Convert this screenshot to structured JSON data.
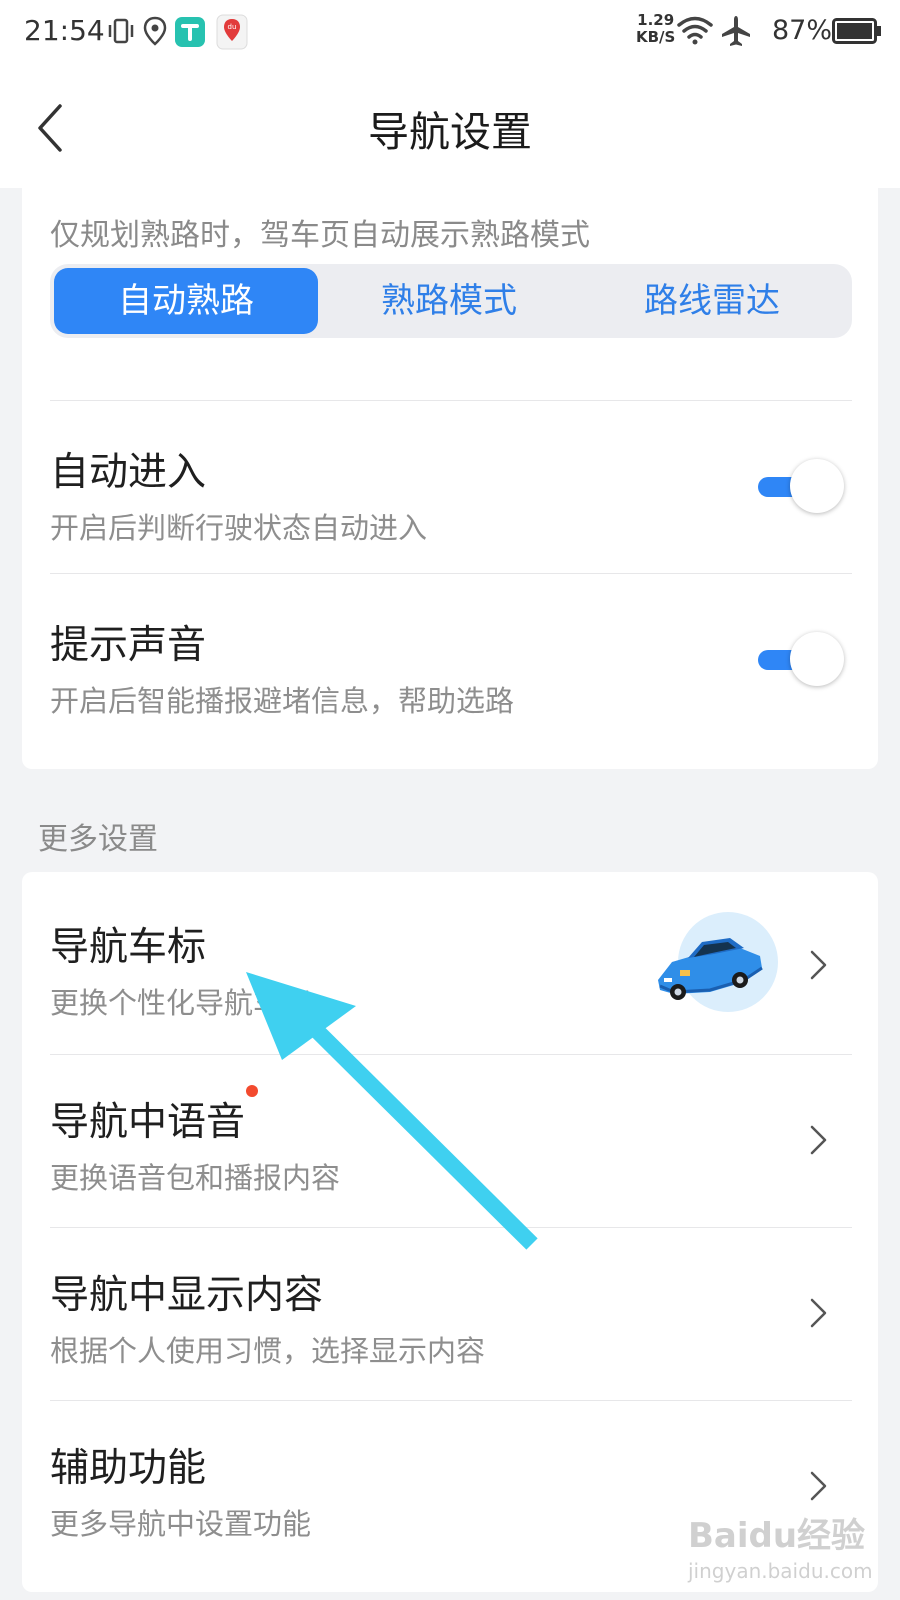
{
  "status_bar": {
    "time": "21:54",
    "speed_value": "1.29",
    "speed_unit": "KB/S",
    "battery_percent": "87%",
    "icons": [
      "vibrate-icon",
      "location-icon",
      "app-t-icon",
      "map-pin-app-icon",
      "wifi-icon",
      "airplane-icon",
      "battery-icon"
    ]
  },
  "header": {
    "title": "导航设置",
    "back_icon": "chevron-left-icon"
  },
  "top_card": {
    "hint": "仅规划熟路时，驾车页自动展示熟路模式",
    "segments": [
      {
        "label": "自动熟路",
        "selected": true
      },
      {
        "label": "熟路模式",
        "selected": false
      },
      {
        "label": "路线雷达",
        "selected": false
      }
    ],
    "toggles": [
      {
        "title": "自动进入",
        "subtitle": "开启后判断行驶状态自动进入",
        "on": true
      },
      {
        "title": "提示声音",
        "subtitle": "开启后智能播报避堵信息，帮助选路",
        "on": true
      }
    ]
  },
  "more_settings": {
    "section_label": "更多设置",
    "items": [
      {
        "title": "导航车标",
        "subtitle": "更换个性化导航车标",
        "icon": "blue-car-icon"
      },
      {
        "title": "导航中语音",
        "subtitle": "更换语音包和播报内容",
        "has_red_dot": true
      },
      {
        "title": "导航中显示内容",
        "subtitle": "根据个人使用习惯，选择显示内容"
      },
      {
        "title": "辅助功能",
        "subtitle": "更多导航中设置功能"
      }
    ]
  },
  "watermark": {
    "main": "Baidu经验",
    "sub": "jingyan.baidu.com"
  },
  "colors": {
    "accent": "#2f86f6",
    "annotation_arrow": "#3fd0f0",
    "red_dot": "#f34a2e",
    "page_bg": "#f2f3f5"
  }
}
